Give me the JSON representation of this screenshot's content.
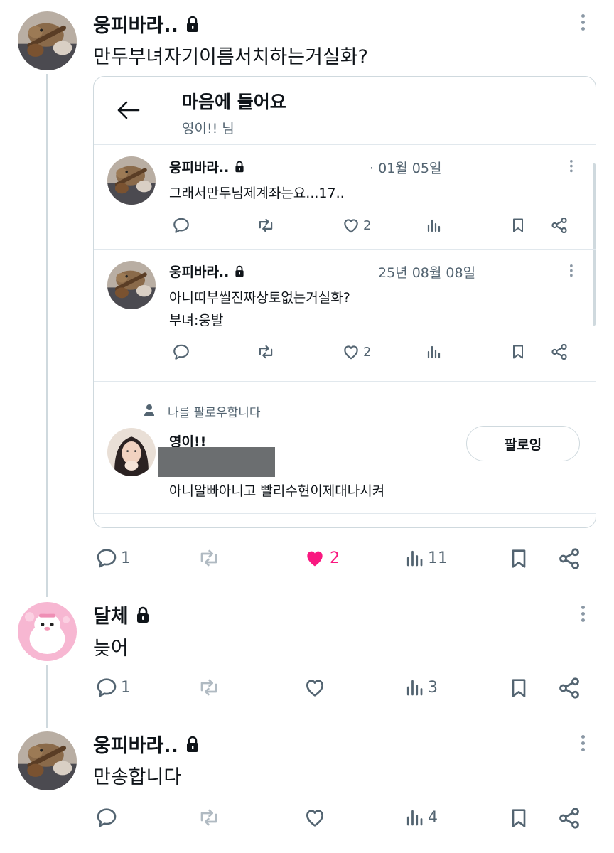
{
  "main_post": {
    "author": "웅피바라..",
    "text": "만두부녀자기이름서치하는거실화?",
    "counts": {
      "reply": "1",
      "retweet": "",
      "like": "2",
      "views": "11"
    }
  },
  "embedded_screen": {
    "title": "마음에 들어요",
    "subtitle": "영이!! 님",
    "tweets": [
      {
        "author": "웅피바라..",
        "date": "· 01월 05일",
        "lines": [
          "그래서만두님제계좌는요...17.."
        ],
        "like": "2"
      },
      {
        "author": "웅피바라..",
        "date": "25년 08월 08일",
        "lines": [
          "아니띠부씰진짜상토없는거실화?",
          "부녀:웅발"
        ],
        "like": "2"
      }
    ],
    "follows_you": "나를 팔로우합니다",
    "user": {
      "name": "영이!!",
      "bio": "아니알빠아니고 빨리수현이제대나시켜",
      "follow_label": "팔로잉"
    }
  },
  "replies": [
    {
      "author": "달체",
      "text": "늦어",
      "counts": {
        "reply": "1",
        "views": "3"
      }
    },
    {
      "author": "웅피바라..",
      "text": "만송합니다",
      "counts": {
        "reply": "",
        "views": "4"
      }
    }
  ],
  "colors": {
    "like_active": "#f91880",
    "icon_gray": "#536471",
    "border": "#cfd9de"
  },
  "icons": [
    "lock-icon",
    "more-icon",
    "back-arrow-icon",
    "reply-icon",
    "retweet-icon",
    "like-icon",
    "views-icon",
    "bookmark-icon",
    "share-icon",
    "person-icon"
  ]
}
